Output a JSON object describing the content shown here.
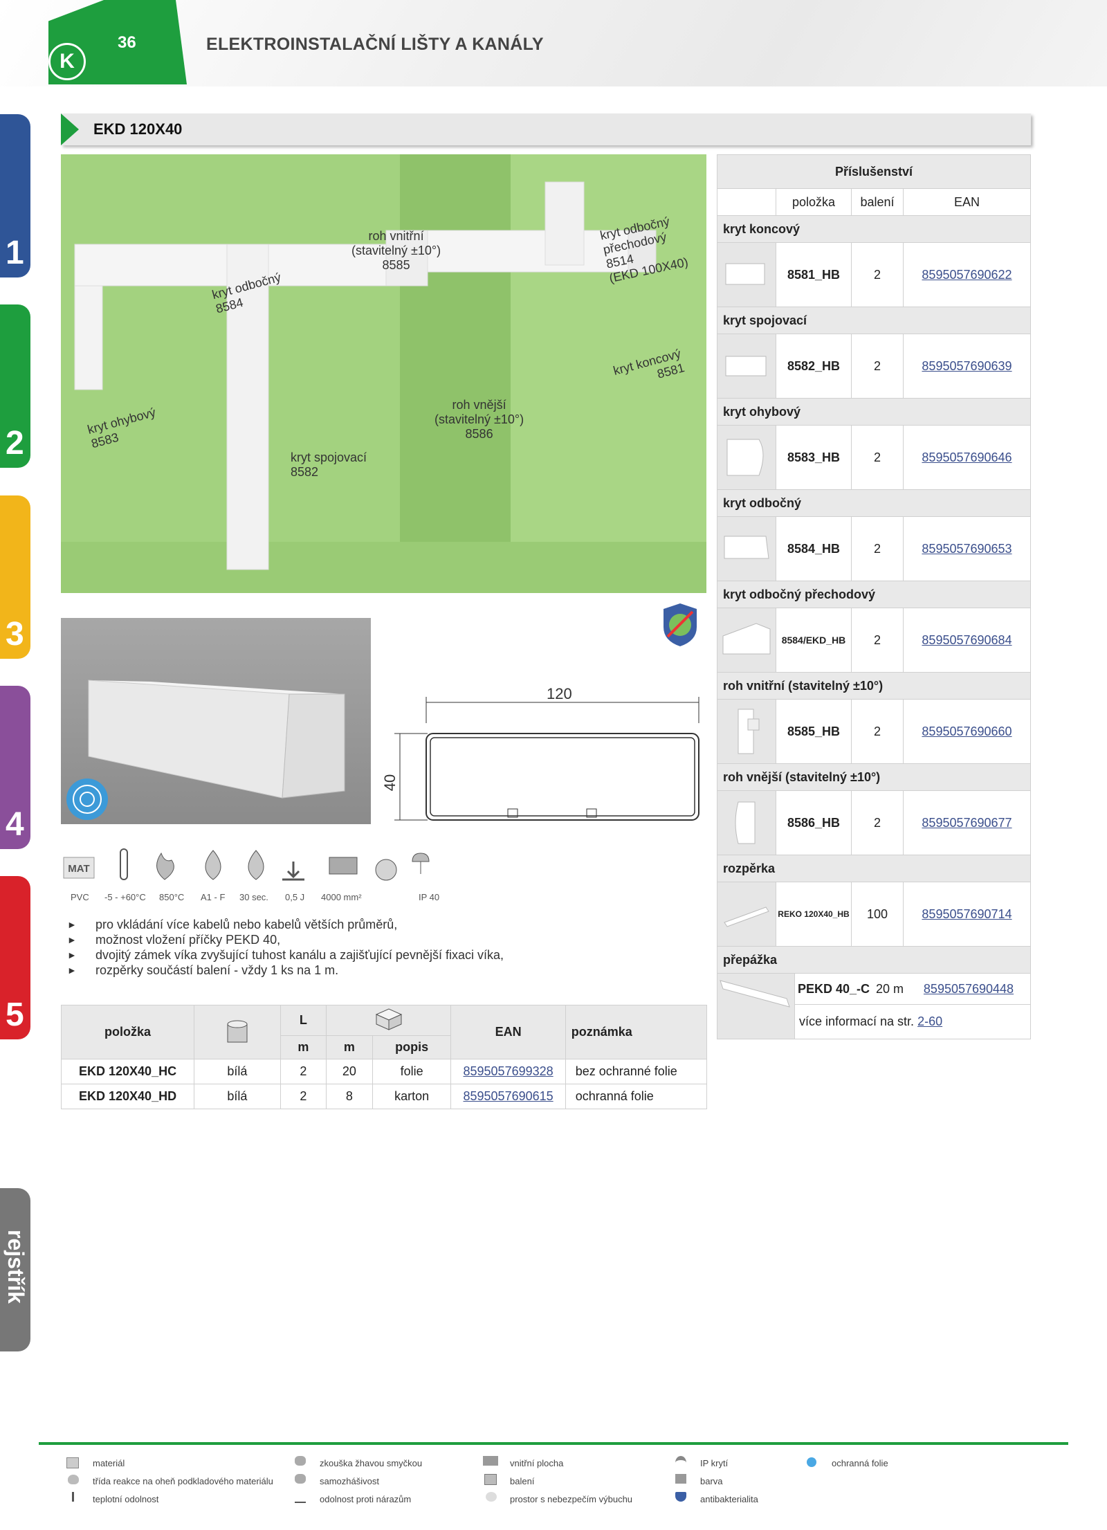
{
  "header": {
    "page_number": "36",
    "title": "ELEKTROINSTALAČNÍ LIŠTY A KANÁLY"
  },
  "side_tabs": [
    "1",
    "2",
    "3",
    "4",
    "5"
  ],
  "side_tab_index": "rejstřík",
  "section_title": "EKD 120X40",
  "photo_labels": {
    "kryt_odbocny": "kryt odbočný\n8584",
    "roh_vnitrni": "roh vnitřní\n(stavitelný ±10°)\n8585",
    "kryt_odbocny_prechodovy": "kryt odbočný\npřechodový\n8514\n(EKD 100X40)",
    "kryt_koncovy": "kryt koncový\n8581",
    "kryt_ohybovy": "kryt ohybový\n8583",
    "roh_vnejsi": "roh vnější\n(stavitelný ±10°)\n8586",
    "kryt_spojovaci": "kryt spojovací\n8582"
  },
  "dimensions": {
    "width": "120",
    "height": "40"
  },
  "icon_captions": [
    "PVC",
    "-5 - +60°C",
    "850°C",
    "A1 - F",
    "30 sec.",
    "0,5 J",
    "4000 mm²",
    "IP 40"
  ],
  "icon_names": [
    "material-icon",
    "thermometer-icon",
    "glow-wire-icon",
    "fire-class-icon",
    "self-extinguishing-icon",
    "impact-icon",
    "inner-area-icon",
    "explosive-icon",
    "ip-icon"
  ],
  "bullets": [
    "pro vkládání více kabelů nebo kabelů větších průměrů,",
    "možnost vložení příčky PEKD 40,",
    "dvojitý zámek víka zvyšující tuhost kanálu a zajišťující pevnější fixaci víka,",
    "rozpěrky součástí balení - vždy 1 ks na 1 m."
  ],
  "product_table": {
    "headers": {
      "polozka": "položka",
      "L": "L",
      "EAN": "EAN",
      "poznamka": "poznámka"
    },
    "subheaders": [
      "m",
      "m",
      "popis"
    ],
    "rows": [
      {
        "polozka": "EKD 120X40_HC",
        "barva": "bílá",
        "L": "2",
        "m": "20",
        "popis": "folie",
        "ean": "8595057699328",
        "poznamka": "bez ochranné folie"
      },
      {
        "polozka": "EKD 120X40_HD",
        "barva": "bílá",
        "L": "2",
        "m": "8",
        "popis": "karton",
        "ean": "8595057690615",
        "poznamka": "ochranná folie"
      }
    ]
  },
  "accessories": {
    "title": "Příslušenství",
    "columns": [
      "položka",
      "balení",
      "EAN"
    ],
    "groups": [
      {
        "category": "kryt koncový",
        "code": "8581_HB",
        "qty": "2",
        "ean": "8595057690622"
      },
      {
        "category": "kryt spojovací",
        "code": "8582_HB",
        "qty": "2",
        "ean": "8595057690639"
      },
      {
        "category": "kryt ohybový",
        "code": "8583_HB",
        "qty": "2",
        "ean": "8595057690646"
      },
      {
        "category": "kryt odbočný",
        "code": "8584_HB",
        "qty": "2",
        "ean": "8595057690653"
      },
      {
        "category": "kryt odbočný přechodový",
        "code": "8584/EKD_HB",
        "qty": "2",
        "ean": "8595057690684"
      },
      {
        "category": "roh vnitřní (stavitelný ±10°)",
        "code": "8585_HB",
        "qty": "2",
        "ean": "8595057690660"
      },
      {
        "category": "roh vnější (stavitelný ±10°)",
        "code": "8586_HB",
        "qty": "2",
        "ean": "8595057690677"
      },
      {
        "category": "rozpěrka",
        "code": "REKO 120X40_HB",
        "qty": "100",
        "ean": "8595057690714"
      }
    ],
    "last": {
      "category": "přepážka",
      "code": "PEKD 40_-C",
      "qty": "20 m",
      "ean": "8595057690448"
    },
    "more_info": "více informací na str.",
    "more_info_link": "2-60"
  },
  "legend": [
    "materiál",
    "třída reakce na oheň podkladového materiálu",
    "teplotní odolnost",
    "zkouška žhavou smyčkou",
    "samozhášivost",
    "odolnost proti nárazům",
    "vnitřní plocha",
    "balení",
    "prostor s nebezpečím výbuchu",
    "IP krytí",
    "barva",
    "antibakterialita",
    "ochranná folie"
  ],
  "colors": {
    "brand_green": "#1e9e3e",
    "tab1": "#2f5597",
    "tab2": "#1e9e3e",
    "tab3": "#f2b51a",
    "tab4": "#8a4f9a",
    "tab5": "#d9222a",
    "wall": "#9fd07a",
    "link": "#3b4f8c"
  }
}
